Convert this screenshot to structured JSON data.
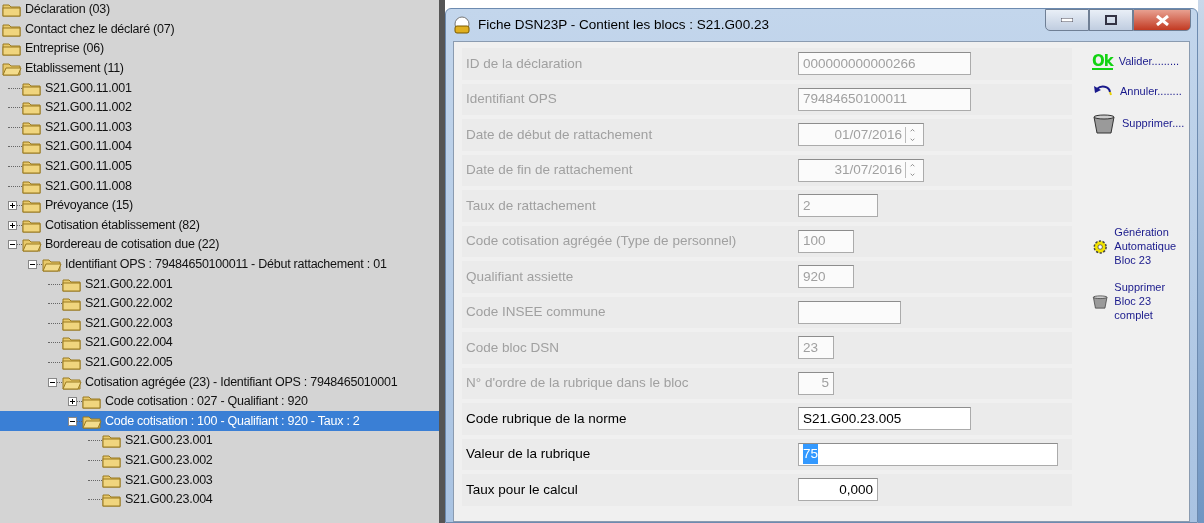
{
  "tree": [
    {
      "label": "Déclaration (03)",
      "selected": false
    },
    {
      "label": "Contact chez le déclaré (07)",
      "selected": false
    },
    {
      "label": "Entreprise (06)",
      "selected": false
    },
    {
      "label": "Etablissement (11)",
      "selected": false,
      "expanded": true,
      "children": [
        {
          "label": "S21.G00.11.001",
          "selected": false
        },
        {
          "label": "S21.G00.11.002",
          "selected": false
        },
        {
          "label": "S21.G00.11.003",
          "selected": false
        },
        {
          "label": "S21.G00.11.004",
          "selected": false
        },
        {
          "label": "S21.G00.11.005",
          "selected": false
        },
        {
          "label": "S21.G00.11.008",
          "selected": false
        },
        {
          "label": "Prévoyance (15)",
          "selected": false,
          "expanded": false
        },
        {
          "label": "Cotisation établissement (82)",
          "selected": false,
          "expanded": false
        },
        {
          "label": "Bordereau de cotisation due (22)",
          "selected": false,
          "expanded": true,
          "children": [
            {
              "label": "Identifiant OPS : 79484650100011 - Début rattachement : 01",
              "selected": false,
              "expanded": true,
              "children": [
                {
                  "label": "S21.G00.22.001",
                  "selected": false
                },
                {
                  "label": "S21.G00.22.002",
                  "selected": false
                },
                {
                  "label": "S21.G00.22.003",
                  "selected": false
                },
                {
                  "label": "S21.G00.22.004",
                  "selected": false
                },
                {
                  "label": "S21.G00.22.005",
                  "selected": false
                },
                {
                  "label": "Cotisation agrégée (23) - Identifiant OPS : 7948465010001",
                  "selected": false,
                  "expanded": true,
                  "children": [
                    {
                      "label": "Code cotisation : 027 - Qualifiant : 920",
                      "selected": false,
                      "expanded": false
                    },
                    {
                      "label": "Code cotisation : 100 - Qualifiant : 920 - Taux : 2",
                      "selected": true,
                      "expanded": true,
                      "children": [
                        {
                          "label": "S21.G00.23.001",
                          "selected": false
                        },
                        {
                          "label": "S21.G00.23.002",
                          "selected": false
                        },
                        {
                          "label": "S21.G00.23.003",
                          "selected": false
                        },
                        {
                          "label": "S21.G00.23.004",
                          "selected": false
                        }
                      ]
                    }
                  ]
                }
              ]
            }
          ]
        }
      ]
    }
  ],
  "window": {
    "title": "Fiche DSN23P - Contient les blocs : S21.G00.23"
  },
  "fields": [
    {
      "kind": "text",
      "label": "ID de la déclaration",
      "value": "000000000000266",
      "disabled": true
    },
    {
      "kind": "text",
      "label": "Identifiant OPS",
      "value": "79484650100011",
      "disabled": true
    },
    {
      "kind": "date",
      "label": "Date de début de rattachement",
      "value": "01/07/2016",
      "disabled": true
    },
    {
      "kind": "date",
      "label": "Date de fin de rattachement",
      "value": "31/07/2016",
      "disabled": true
    },
    {
      "kind": "text",
      "label": "Taux de rattachement",
      "value": "2",
      "disabled": true
    },
    {
      "kind": "text",
      "label": "Code cotisation agrégée (Type de personnel)",
      "value": "100",
      "disabled": true
    },
    {
      "kind": "text",
      "label": "Qualifiant assiette",
      "value": "920",
      "disabled": true
    },
    {
      "kind": "text",
      "label": "Code INSEE commune",
      "disabled": true
    },
    {
      "kind": "text",
      "label": "Code bloc DSN",
      "value": "23",
      "disabled": true
    },
    {
      "kind": "number",
      "label": "N° d'ordre de la rubrique dans le bloc",
      "value": "5",
      "disabled": true
    },
    {
      "kind": "text",
      "label": "Code rubrique de la norme",
      "value": "S21.G00.23.005",
      "disabled": false
    },
    {
      "kind": "text",
      "label": "Valeur de la rubrique",
      "value": "75",
      "disabled": false,
      "text_selected": true
    },
    {
      "kind": "number",
      "label": "Taux pour le calcul",
      "value": "0,000",
      "disabled": false
    }
  ],
  "actions": [
    {
      "kind": "ok",
      "icon_text": "Ok",
      "label": "Valider........."
    },
    {
      "kind": "undo",
      "label": "Annuler........"
    },
    {
      "kind": "trash",
      "label": "Supprimer...."
    },
    {
      "kind": "gear",
      "label": "Génération Automatique Bloc 23"
    },
    {
      "kind": "trash",
      "label": "Supprimer Bloc 23 complet"
    }
  ]
}
